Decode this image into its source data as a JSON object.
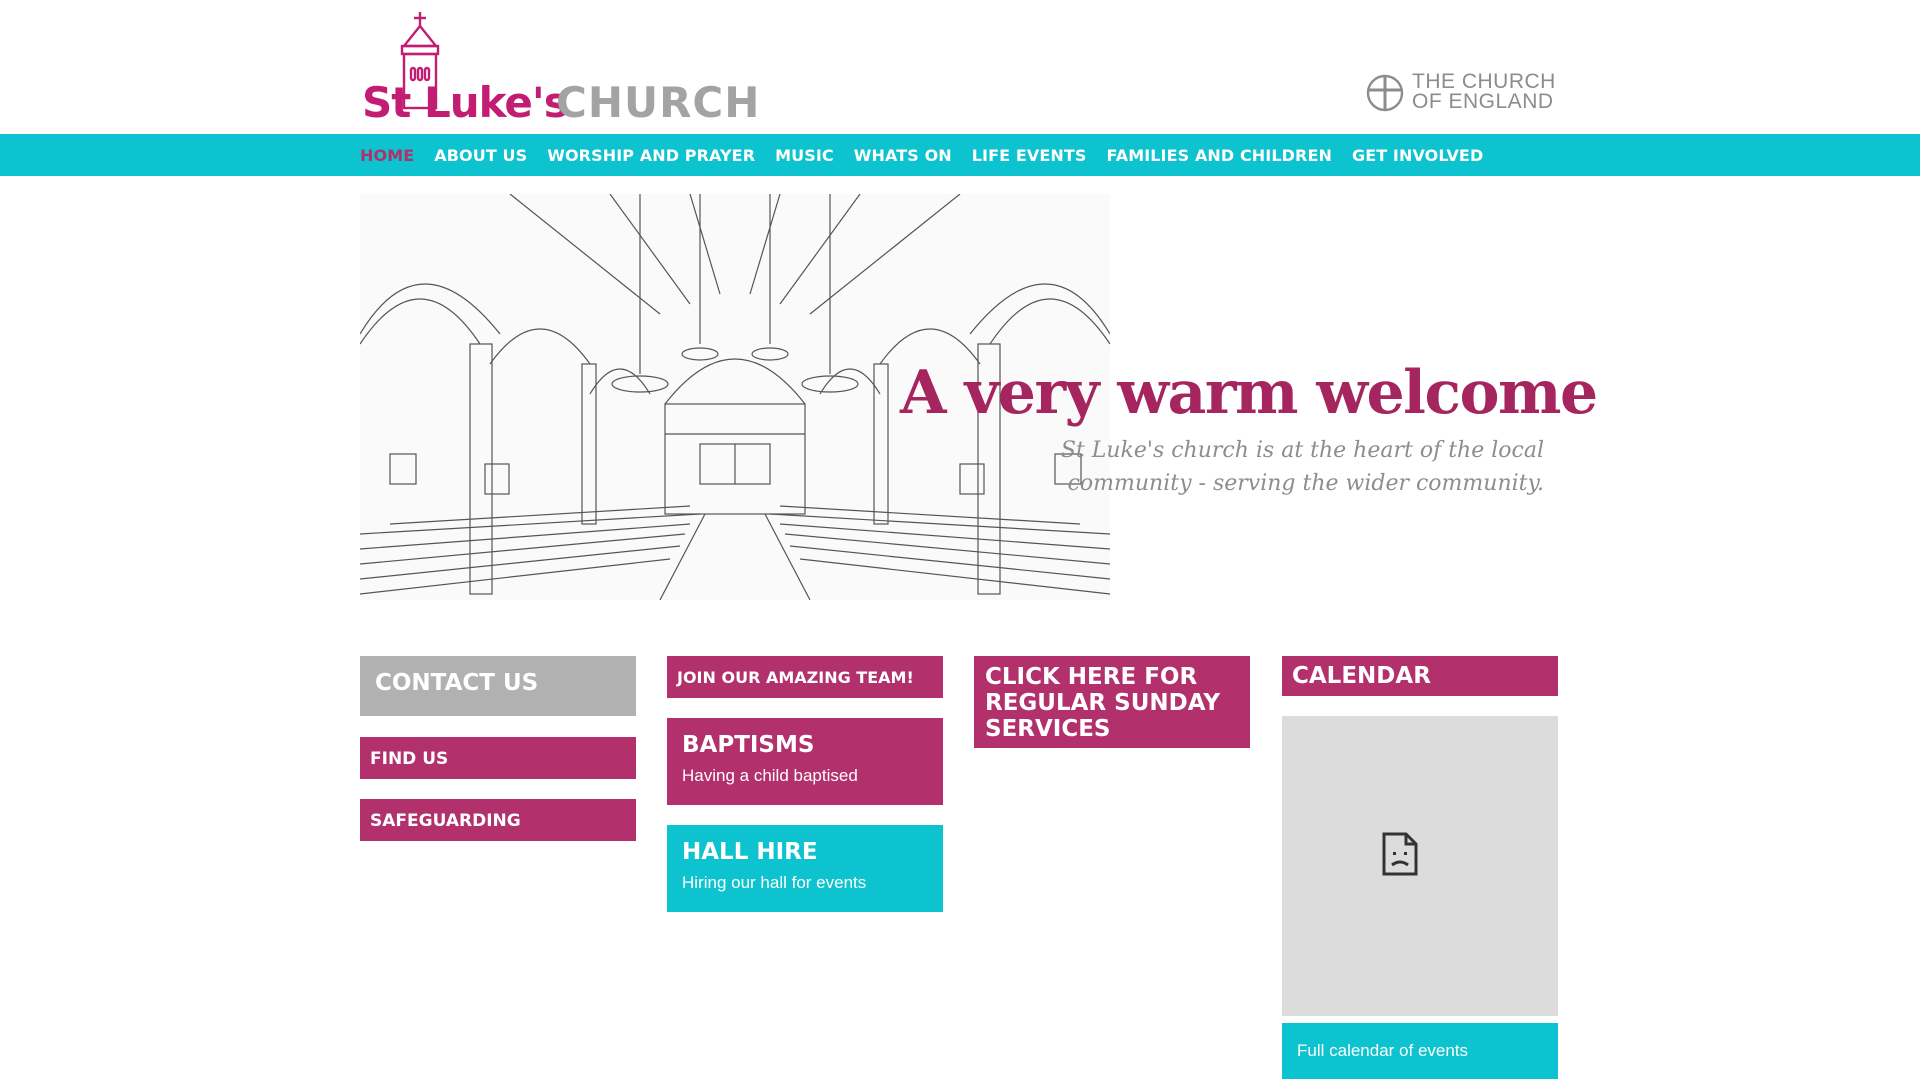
{
  "header": {
    "logo_st": "St Luke's",
    "logo_church": "CHURCH",
    "coe_text": "THE CHURCH\nOF ENGLAND",
    "icons": [
      "church-tower-logo-icon",
      "church-of-england-logo-icon"
    ]
  },
  "nav": {
    "items": [
      {
        "label": "HOME",
        "active": true
      },
      {
        "label": "ABOUT US"
      },
      {
        "label": "WORSHIP AND PRAYER"
      },
      {
        "label": "MUSIC"
      },
      {
        "label": "WHATS ON"
      },
      {
        "label": "LIFE EVENTS"
      },
      {
        "label": "FAMILIES AND CHILDREN"
      },
      {
        "label": "GET INVOLVED"
      }
    ]
  },
  "hero": {
    "title": "A very warm welcome",
    "subtitle": "St Luke's church is at the heart of the local community - serving the wider community."
  },
  "tiles": {
    "contact": "CONTACT US",
    "find_us": "FIND US",
    "safeguarding": "SAFEGUARDING",
    "join_team": "JOIN OUR AMAZING TEAM!",
    "baptisms_title": "BAPTISMS",
    "baptisms_sub": "Having a child baptised",
    "hall_title": "HALL HIRE",
    "hall_sub": "Hiring our hall for events",
    "sunday": "CLICK HERE FOR REGULAR SUNDAY SERVICES",
    "calendar_title": "CALENDAR",
    "calendar_link": "Full calendar of events"
  },
  "colors": {
    "magenta": "#b2306b",
    "teal": "#0dc3cf",
    "grey": "#b1b1b1",
    "title_red": "#a5255e"
  }
}
